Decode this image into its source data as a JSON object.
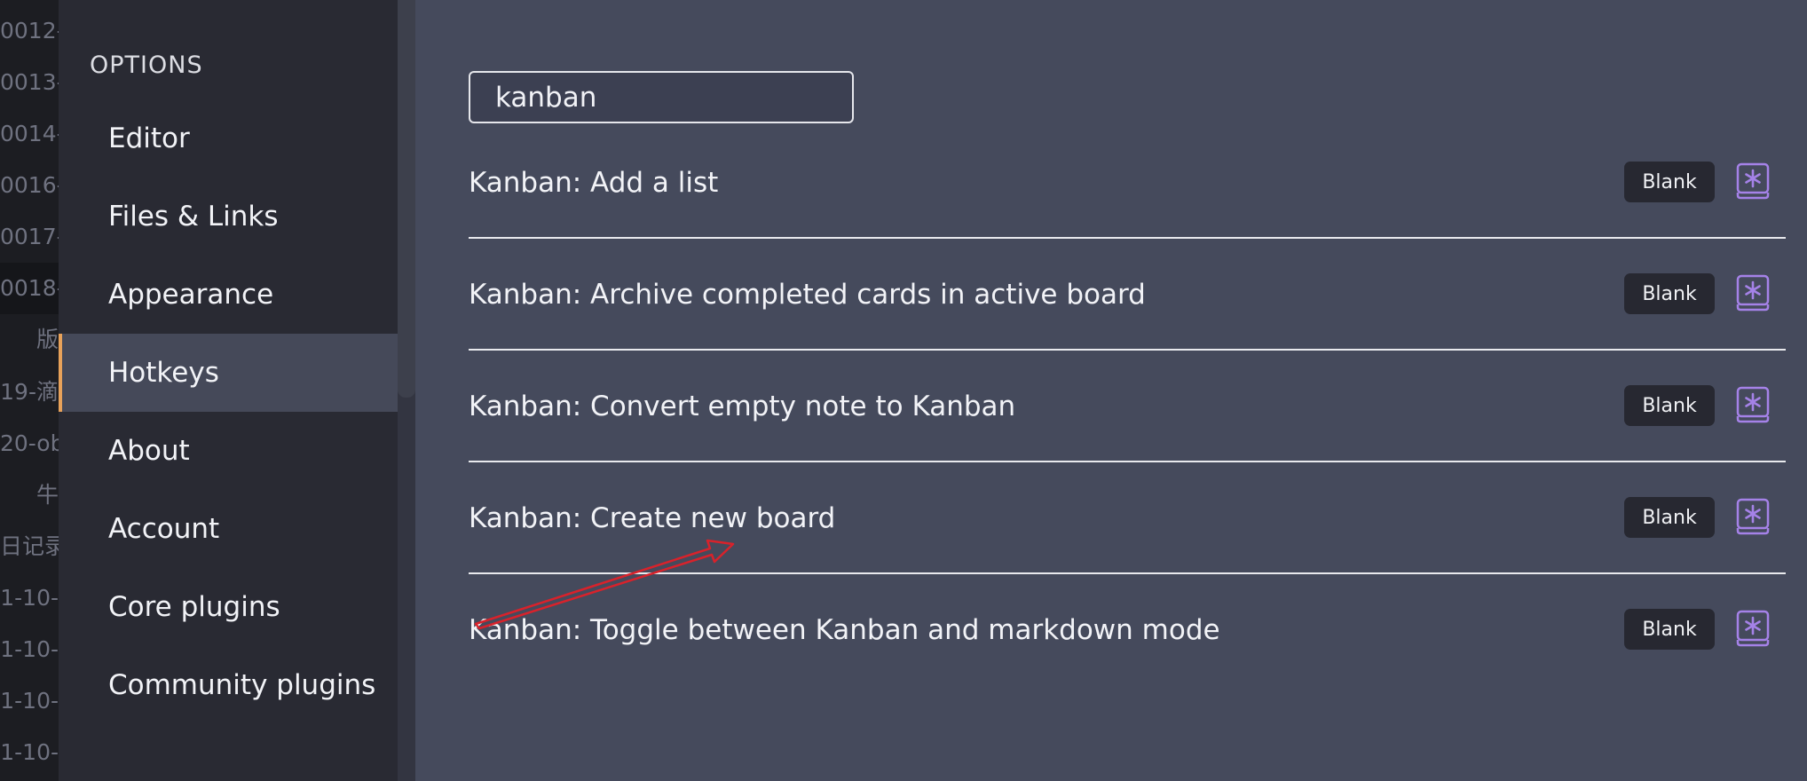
{
  "file_list": [
    "0012-",
    "0013-",
    "0014-",
    "0016-",
    "0017-",
    "0018-",
    "版",
    "19-滴",
    "20-ob",
    "牛",
    "日记录",
    "1-10-",
    "1-10-",
    "1-10-",
    "1-10-"
  ],
  "sidebar": {
    "header": "OPTIONS",
    "items": [
      {
        "label": "Editor"
      },
      {
        "label": "Files & Links"
      },
      {
        "label": "Appearance"
      },
      {
        "label": "Hotkeys",
        "active": true
      },
      {
        "label": "About"
      },
      {
        "label": "Account"
      },
      {
        "label": "Core plugins"
      },
      {
        "label": "Community plugins"
      }
    ]
  },
  "search": {
    "value": "kanban"
  },
  "hotkeys": [
    {
      "command": "Kanban: Add a list",
      "hotkey": "Blank"
    },
    {
      "command": "Kanban: Archive completed cards in active board",
      "hotkey": "Blank"
    },
    {
      "command": "Kanban: Convert empty note to Kanban",
      "hotkey": "Blank"
    },
    {
      "command": "Kanban: Create new board",
      "hotkey": "Blank"
    },
    {
      "command": "Kanban: Toggle between Kanban and markdown mode",
      "hotkey": "Blank"
    }
  ],
  "colors": {
    "accent": "#e8a25a",
    "icon": "#a582e8",
    "annotation": "#d8222b"
  },
  "icons": {
    "set_hotkey": "set-hotkey-icon"
  }
}
